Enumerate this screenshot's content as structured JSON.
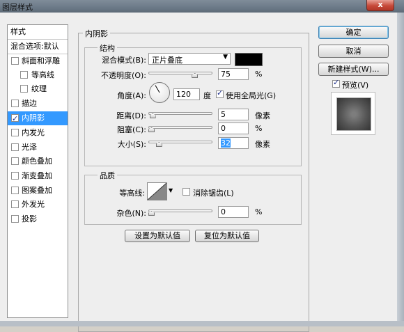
{
  "window": {
    "title": "图层样式",
    "close_glyph": "x"
  },
  "sidebar": {
    "header": "样式",
    "blend_default": "混合选项:默认",
    "items": [
      {
        "label": "斜面和浮雕",
        "checked": false,
        "sub": false
      },
      {
        "label": "等高线",
        "checked": false,
        "sub": true
      },
      {
        "label": "纹理",
        "checked": false,
        "sub": true
      },
      {
        "label": "描边",
        "checked": false,
        "sub": false
      },
      {
        "label": "内阴影",
        "checked": true,
        "sub": false,
        "selected": true
      },
      {
        "label": "内发光",
        "checked": false,
        "sub": false
      },
      {
        "label": "光泽",
        "checked": false,
        "sub": false
      },
      {
        "label": "颜色叠加",
        "checked": false,
        "sub": false
      },
      {
        "label": "渐变叠加",
        "checked": false,
        "sub": false
      },
      {
        "label": "图案叠加",
        "checked": false,
        "sub": false
      },
      {
        "label": "外发光",
        "checked": false,
        "sub": false
      },
      {
        "label": "投影",
        "checked": false,
        "sub": false
      }
    ]
  },
  "panel": {
    "title": "内阴影",
    "structure": {
      "title": "结构",
      "blend_mode_label": "混合模式(B):",
      "blend_mode_value": "正片叠底",
      "shadow_color": "#000000",
      "opacity_label": "不透明度(O):",
      "opacity_value": "75",
      "opacity_unit": "%",
      "opacity_level": 0.75,
      "angle_label": "角度(A):",
      "angle_value": "120",
      "angle_unit": "度",
      "angle_degrees": 120,
      "global_light_label": "使用全局光(G)",
      "global_light_checked": true,
      "distance_label": "距离(D):",
      "distance_value": "5",
      "distance_unit": "像素",
      "distance_level": 0.02,
      "choke_label": "阻塞(C):",
      "choke_value": "0",
      "choke_unit": "%",
      "choke_level": 0,
      "size_label": "大小(S):",
      "size_value": "32",
      "size_unit": "像素",
      "size_level": 0.13
    },
    "quality": {
      "title": "品质",
      "contour_label": "等高线:",
      "antialias_label": "消除锯齿(L)",
      "antialias_checked": false,
      "noise_label": "杂色(N):",
      "noise_value": "0",
      "noise_unit": "%",
      "noise_level": 0
    },
    "buttons": {
      "make_default": "设置为默认值",
      "reset_default": "复位为默认值"
    }
  },
  "actions": {
    "ok": "确定",
    "cancel": "取消",
    "new_style": "新建样式(W)...",
    "preview_label": "预览(V)",
    "preview_checked": true
  },
  "colors": {
    "selection": "#3399ff",
    "window_bg": "#eeeeee"
  }
}
